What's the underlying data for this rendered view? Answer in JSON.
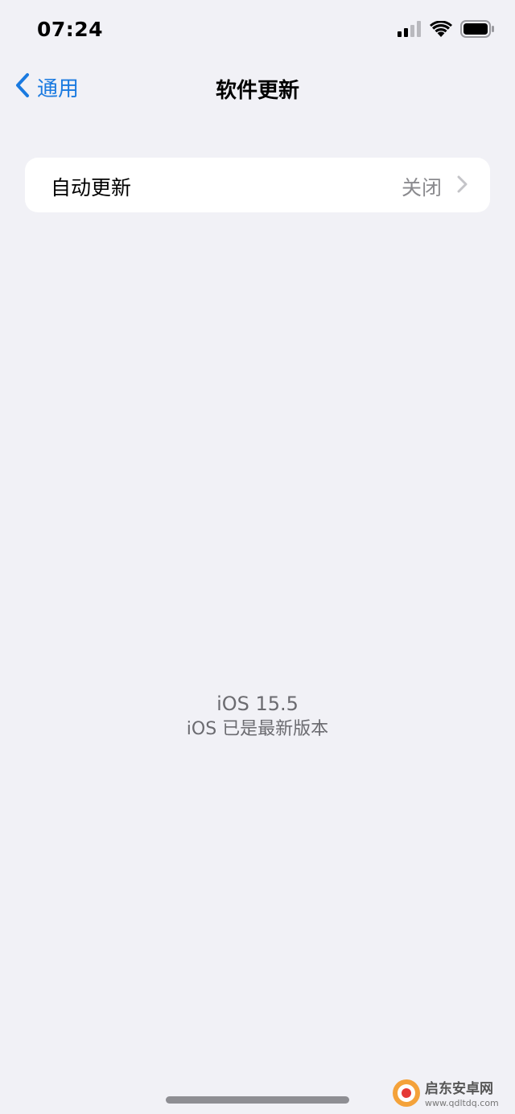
{
  "status_bar": {
    "time": "07:24",
    "icons": [
      "cellular-signal-icon",
      "wifi-icon",
      "battery-icon"
    ]
  },
  "nav": {
    "back_label": "通用",
    "title": "软件更新"
  },
  "settings": {
    "rows": [
      {
        "label": "自动更新",
        "value": "关闭"
      }
    ]
  },
  "version": {
    "name": "iOS 15.5",
    "status": "iOS 已是最新版本"
  },
  "watermark": {
    "title": "启东安卓网",
    "url": "www.qdltdq.com"
  },
  "colors": {
    "background": "#f1f1f6",
    "accent": "#1a7ae0",
    "secondary_text": "#8a8a8e",
    "card": "#ffffff"
  }
}
